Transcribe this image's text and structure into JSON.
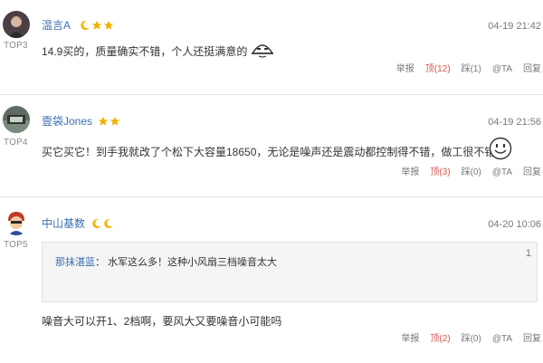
{
  "comments": [
    {
      "rank": "TOP3",
      "name": "温言A",
      "time": "04-19 21:42",
      "text": "14.9买的，质量确实不错，个人还挺满意的",
      "emoji": "smug-face-emoji",
      "badges": [
        "moon",
        "star",
        "star"
      ],
      "actions": {
        "report": "举报",
        "up": "顶(12)",
        "down": "踩(1)",
        "at": "@TA",
        "reply": "回复"
      }
    },
    {
      "rank": "TOP4",
      "name": "壹袋Jones",
      "time": "04-19 21:56",
      "text": "买它买它！到手我就改了个松下大容量18650，无论是噪声还是震动都控制得不错，做工很不错",
      "emoji": "smile-face-emoji",
      "badges": [
        "star",
        "star"
      ],
      "actions": {
        "report": "举报",
        "up": "顶(3)",
        "down": "踩(0)",
        "at": "@TA",
        "reply": "回复"
      }
    },
    {
      "rank": "TOP5",
      "name": "中山基数",
      "time": "04-20 10:06",
      "quote": {
        "name": "那抹湛蓝",
        "sep": "：",
        "text": "水军这么多！这种小风扇三档噪音太大",
        "floor": "1"
      },
      "text": "噪音大可以开1、2档啊，要风大又要噪音小可能吗",
      "badges": [
        "moon",
        "moon"
      ],
      "actions": {
        "report": "举报",
        "up": "顶(2)",
        "down": "踩(0)",
        "at": "@TA",
        "reply": "回复"
      }
    }
  ],
  "colors": {
    "name": "#3a6fb0",
    "up": "#d9534f",
    "badge_gold": "#f0b400"
  }
}
